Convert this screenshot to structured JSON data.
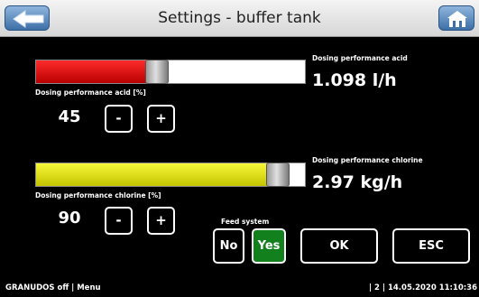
{
  "header": {
    "title": "Settings - buffer tank",
    "back_icon": "arrow-left-icon",
    "home_icon": "house-icon"
  },
  "acid": {
    "result_label": "Dosing performance acid",
    "result_value": "1.098 l/h",
    "percent_label": "Dosing performance acid [%]",
    "percent_value": "45",
    "slider_fraction": 0.45,
    "minus_label": "-",
    "plus_label": "+",
    "fill_color": "#e00000"
  },
  "chlorine": {
    "result_label": "Dosing performance chlorine",
    "result_value": "2.97 kg/h",
    "percent_label": "Dosing performance chlorine [%]",
    "percent_value": "90",
    "slider_fraction": 0.9,
    "minus_label": "-",
    "plus_label": "+",
    "fill_color": "#e6e600"
  },
  "feed_system": {
    "label": "Feed system",
    "no_label": "No",
    "yes_label": "Yes",
    "selected": "Yes"
  },
  "actions": {
    "ok_label": "OK",
    "esc_label": "ESC"
  },
  "footer": {
    "left": "GRANUDOS off | Menu",
    "right": "| 2 | 14.05.2020 11:10:36"
  }
}
